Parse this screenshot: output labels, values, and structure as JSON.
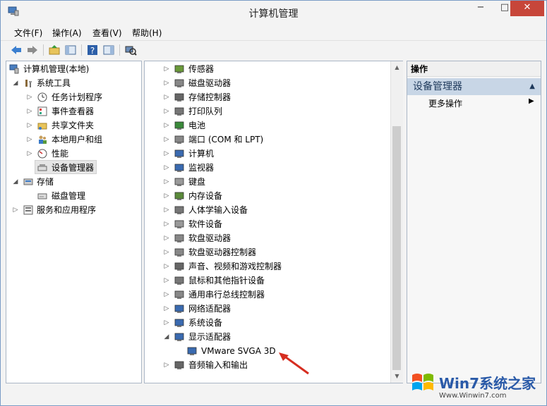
{
  "window": {
    "title": "计算机管理",
    "controls": {
      "min": "−",
      "max": "□",
      "close": "✕"
    }
  },
  "menu": [
    {
      "label": "文件(F)"
    },
    {
      "label": "操作(A)"
    },
    {
      "label": "查看(V)"
    },
    {
      "label": "帮助(H)"
    }
  ],
  "left_tree": {
    "root": "计算机管理(本地)",
    "system_tools": "系统工具",
    "items": [
      {
        "label": "任务计划程序"
      },
      {
        "label": "事件查看器"
      },
      {
        "label": "共享文件夹"
      },
      {
        "label": "本地用户和组"
      },
      {
        "label": "性能"
      },
      {
        "label": "设备管理器"
      }
    ],
    "storage": "存储",
    "disk_mgmt": "磁盘管理",
    "services": "服务和应用程序"
  },
  "device_tree": [
    {
      "label": "传感器"
    },
    {
      "label": "磁盘驱动器"
    },
    {
      "label": "存储控制器"
    },
    {
      "label": "打印队列"
    },
    {
      "label": "电池"
    },
    {
      "label": "端口 (COM 和 LPT)"
    },
    {
      "label": "计算机"
    },
    {
      "label": "监视器"
    },
    {
      "label": "键盘"
    },
    {
      "label": "内存设备"
    },
    {
      "label": "人体学输入设备"
    },
    {
      "label": "软件设备"
    },
    {
      "label": "软盘驱动器"
    },
    {
      "label": "软盘驱动器控制器"
    },
    {
      "label": "声音、视频和游戏控制器"
    },
    {
      "label": "鼠标和其他指针设备"
    },
    {
      "label": "通用串行总线控制器"
    },
    {
      "label": "网络适配器"
    },
    {
      "label": "系统设备"
    },
    {
      "label": "显示适配器"
    },
    {
      "label": "VMware SVGA 3D"
    },
    {
      "label": "音频输入和输出"
    }
  ],
  "actions": {
    "header": "操作",
    "selected": "设备管理器",
    "more": "更多操作"
  },
  "watermark": {
    "brand": "Win7系统之家",
    "url": "Www.Winwin7.com"
  }
}
